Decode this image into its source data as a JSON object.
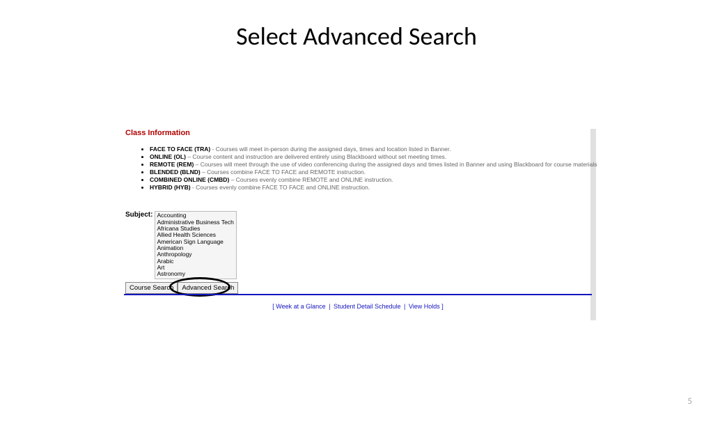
{
  "title": "Select Advanced Search",
  "class_info_header": "Class Information",
  "modalities": [
    {
      "term": "FACE TO FACE (TRA)",
      "desc": " - Courses will meet in-person during the assigned days, times and location listed in Banner."
    },
    {
      "term": "ONLINE (OL)",
      "desc": " – Course content and instruction are delivered entirely using Blackboard without set meeting times."
    },
    {
      "term": "REMOTE (REM)",
      "desc": " – Courses will meet through the use of video conferencing during the assigned days and times listed in Banner and using Blackboard for course materials"
    },
    {
      "term": "BLENDED (BLND)",
      "desc": " – Courses combine FACE TO FACE and REMOTE instruction."
    },
    {
      "term": "COMBINED ONLINE (CMBD)",
      "desc": " – Courses evenly combine REMOTE and ONLINE instruction."
    },
    {
      "term": "HYBRID (HYB)",
      "desc": " - Courses evenly combine FACE TO FACE and ONLINE instruction."
    }
  ],
  "subject_label": "Subject:",
  "subjects": [
    "Accounting",
    "Administrative Business Tech",
    "Africana Studies",
    "Allied Health Sciences",
    "American Sign Language",
    "Animation",
    "Anthropology",
    "Arabic",
    "Art",
    "Astronomy"
  ],
  "buttons": {
    "course_search": "Course Search",
    "advanced_search": "Advanced Search"
  },
  "footer": {
    "open": "[ ",
    "link1": "Week at a Glance",
    "link2": "Student Detail Schedule",
    "link3": "View Holds",
    "close": " ]"
  },
  "page_number": "5"
}
